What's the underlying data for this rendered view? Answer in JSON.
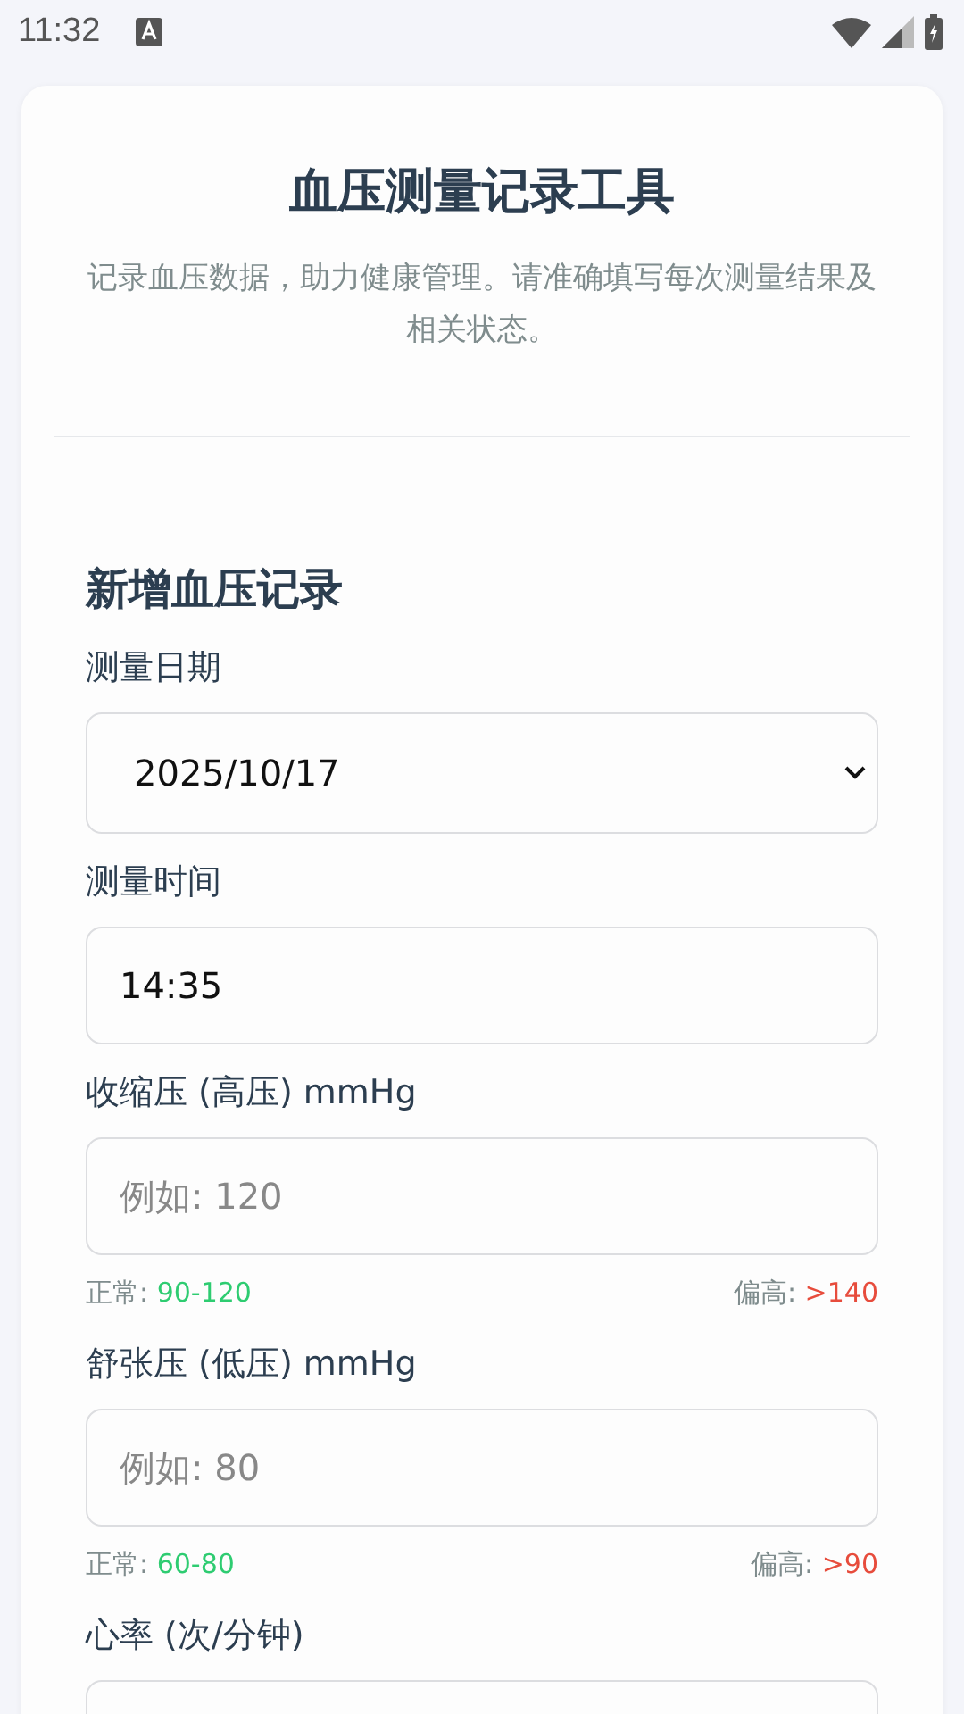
{
  "status_bar": {
    "time": "11:32"
  },
  "header": {
    "title": "血压测量记录工具",
    "subtitle": "记录血压数据，助力健康管理。请准确填写每次测量结果及相关状态。"
  },
  "form": {
    "title": "新增血压记录",
    "fields": [
      {
        "kind": "select",
        "label": "测量日期",
        "value": "2025/10/17"
      },
      {
        "kind": "time",
        "label": "测量时间",
        "value": "14:35"
      },
      {
        "kind": "number",
        "label": "收缩压 (高压) mmHg",
        "placeholder": "例如: 120",
        "hint": {
          "normal_label": "正常:",
          "normal_value": "90-120",
          "high_label": "偏高:",
          "high_value": ">140"
        }
      },
      {
        "kind": "number",
        "label": "舒张压 (低压) mmHg",
        "placeholder": "例如: 80",
        "hint": {
          "normal_label": "正常:",
          "normal_value": "60-80",
          "high_label": "偏高:",
          "high_value": ">90"
        }
      },
      {
        "kind": "number",
        "label": "心率 (次/分钟)"
      }
    ]
  }
}
